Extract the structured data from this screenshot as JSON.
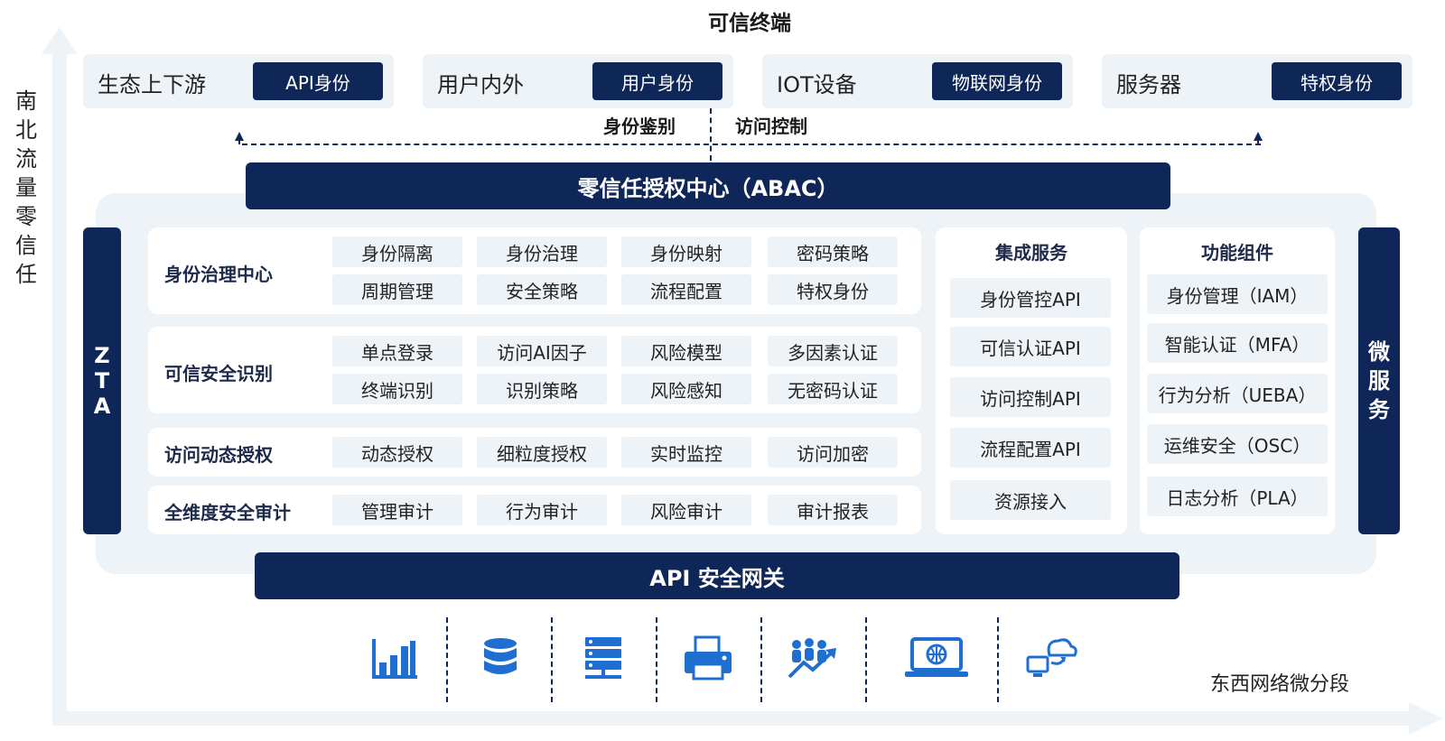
{
  "title": "可信终端",
  "axes": {
    "vertical_label": "南北流量零信任",
    "horizontal_label": "东西网络微分段"
  },
  "top_cards": [
    {
      "label": "生态上下游",
      "badge": "API身份"
    },
    {
      "label": "用户内外",
      "badge": "用户身份"
    },
    {
      "label": "IOT设备",
      "badge": "物联网身份"
    },
    {
      "label": "服务器",
      "badge": "特权身份"
    }
  ],
  "connectors": {
    "left": "身份鉴别",
    "right": "访问控制"
  },
  "center_bar": "零信任授权中心（ABAC）",
  "left_sidebar": [
    "Z",
    "T",
    "A"
  ],
  "right_sidebar": [
    "微",
    "服",
    "务"
  ],
  "rows": [
    {
      "label": "身份治理中心",
      "items": [
        "身份隔离",
        "身份治理",
        "身份映射",
        "密码策略",
        "周期管理",
        "安全策略",
        "流程配置",
        "特权身份"
      ]
    },
    {
      "label": "可信安全识别",
      "items": [
        "单点登录",
        "访问AI因子",
        "风险模型",
        "多因素认证",
        "终端识别",
        "识别策略",
        "风险感知",
        "无密码认证"
      ]
    },
    {
      "label": "访问动态授权",
      "items": [
        "动态授权",
        "细粒度授权",
        "实时监控",
        "访问加密"
      ]
    },
    {
      "label": "全维度安全审计",
      "items": [
        "管理审计",
        "行为审计",
        "风险审计",
        "审计报表"
      ]
    }
  ],
  "integration": {
    "title": "集成服务",
    "items": [
      "身份管控API",
      "可信认证API",
      "访问控制API",
      "流程配置API",
      "资源接入"
    ]
  },
  "components": {
    "title": "功能组件",
    "items": [
      "身份管理（IAM）",
      "智能认证（MFA）",
      "行为分析（UEBA）",
      "运维安全（OSC）",
      "日志分析（PLA）"
    ]
  },
  "gateway_bar": "API 安全网关",
  "bottom_icons": [
    "bar-chart-icon",
    "database-icon",
    "server-rack-icon",
    "printer-icon",
    "users-trend-icon",
    "laptop-globe-icon",
    "cloud-computer-icon"
  ],
  "colors": {
    "navy": "#0f2658",
    "panel": "#eef3f8",
    "icon_blue": "#1f6fd1"
  }
}
